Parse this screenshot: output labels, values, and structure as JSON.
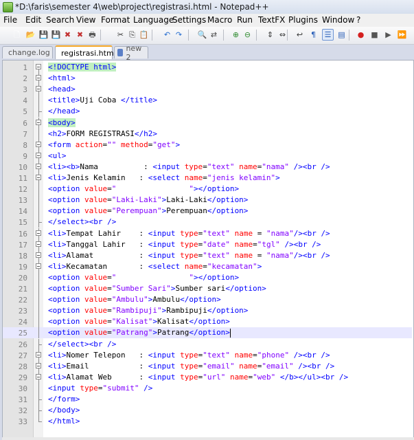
{
  "window": {
    "title": "*D:\\faris\\semester 4\\web\\project\\registrasi.html - Notepad++"
  },
  "menu": [
    "File",
    "Edit",
    "Search",
    "View",
    "Format",
    "Language",
    "Settings",
    "Macro",
    "Run",
    "TextFX",
    "Plugins",
    "Window",
    "?"
  ],
  "toolbar": [
    "new-file-icon",
    "open-file-icon",
    "save-icon",
    "save-all-icon",
    "close-icon",
    "close-all-icon",
    "print-icon",
    "cut-icon",
    "copy-icon",
    "paste-icon",
    "undo-icon",
    "redo-icon",
    "find-icon",
    "replace-icon",
    "zoom-in-icon",
    "zoom-out-icon",
    "sync-vertical-icon",
    "sync-horizontal-icon",
    "word-wrap-icon",
    "show-all-chars-icon",
    "indent-guide-icon",
    "user-lang-icon",
    "record-macro-icon",
    "stop-macro-icon",
    "play-macro-icon",
    "play-multi-icon",
    "save-macro-icon"
  ],
  "tabs": [
    {
      "label": "change.log",
      "active": false,
      "icon_color": "#5b7fc7"
    },
    {
      "label": "registrasi.html",
      "active": true,
      "icon_color": "#e04545"
    },
    {
      "label": "new 2",
      "active": false,
      "icon_color": "#5b7fc7"
    }
  ],
  "colors": {
    "tag": "#0000ff",
    "attribute": "#ff0000",
    "value": "#8000ff",
    "text": "#000000"
  },
  "lines": [
    {
      "n": "1",
      "fold": "open",
      "current": false,
      "tokens": [
        [
          "tag",
          "<!DOCTYPE html>"
        ]
      ],
      "hl": true
    },
    {
      "n": "2",
      "fold": "open",
      "current": false,
      "tokens": [
        [
          "tag",
          "<html>"
        ]
      ]
    },
    {
      "n": "3",
      "fold": "open",
      "current": false,
      "tokens": [
        [
          "tag",
          "<head>"
        ]
      ]
    },
    {
      "n": "4",
      "fold": "mid",
      "current": false,
      "tokens": [
        [
          "tag",
          "<title>"
        ],
        [
          "txt",
          "Uji Coba "
        ],
        [
          "tag",
          "</title>"
        ]
      ]
    },
    {
      "n": "5",
      "fold": "end",
      "current": false,
      "tokens": [
        [
          "tag",
          "</head>"
        ]
      ]
    },
    {
      "n": "6",
      "fold": "open",
      "current": false,
      "tokens": [
        [
          "tag",
          "<body>"
        ]
      ],
      "hl": true
    },
    {
      "n": "7",
      "fold": "mid",
      "current": false,
      "tokens": [
        [
          "tag",
          "<h2>"
        ],
        [
          "txt",
          "FORM REGISTRASI"
        ],
        [
          "tag",
          "</h2>"
        ]
      ]
    },
    {
      "n": "8",
      "fold": "open",
      "current": false,
      "tokens": [
        [
          "tag",
          "<form "
        ],
        [
          "attr",
          "action"
        ],
        [
          "txt",
          "="
        ],
        [
          "val",
          "\"\""
        ],
        [
          "attr",
          " method"
        ],
        [
          "txt",
          "="
        ],
        [
          "val",
          "\"get\""
        ],
        [
          "tag",
          ">"
        ]
      ]
    },
    {
      "n": "9",
      "fold": "open",
      "current": false,
      "tokens": [
        [
          "tag",
          "<ul>"
        ]
      ]
    },
    {
      "n": "10",
      "fold": "open",
      "current": false,
      "tokens": [
        [
          "tag",
          "<li><b>"
        ],
        [
          "txt",
          "Nama          : "
        ],
        [
          "tag",
          "<input "
        ],
        [
          "attr",
          "type"
        ],
        [
          "txt",
          "="
        ],
        [
          "val",
          "\"text\""
        ],
        [
          "attr",
          " name"
        ],
        [
          "txt",
          "="
        ],
        [
          "val",
          "\"nama\""
        ],
        [
          "tag",
          " /><br />"
        ]
      ]
    },
    {
      "n": "11",
      "fold": "open",
      "current": false,
      "tokens": [
        [
          "tag",
          "<li>"
        ],
        [
          "txt",
          "Jenis Kelamin   : "
        ],
        [
          "tag",
          "<select "
        ],
        [
          "attr",
          "name"
        ],
        [
          "txt",
          "="
        ],
        [
          "val",
          "\"jenis kelamin\""
        ],
        [
          "tag",
          ">"
        ]
      ]
    },
    {
      "n": "12",
      "fold": "mid",
      "current": false,
      "tokens": [
        [
          "tag",
          "<option "
        ],
        [
          "attr",
          "value"
        ],
        [
          "txt",
          "="
        ],
        [
          "val",
          "\"                \""
        ],
        [
          "tag",
          "></option>"
        ]
      ]
    },
    {
      "n": "13",
      "fold": "mid",
      "current": false,
      "tokens": [
        [
          "tag",
          "<option "
        ],
        [
          "attr",
          "value"
        ],
        [
          "txt",
          "="
        ],
        [
          "val",
          "\"Laki-Laki\""
        ],
        [
          "tag",
          ">"
        ],
        [
          "txt",
          "Laki-Laki"
        ],
        [
          "tag",
          "</option>"
        ]
      ]
    },
    {
      "n": "14",
      "fold": "mid",
      "current": false,
      "tokens": [
        [
          "tag",
          "<option "
        ],
        [
          "attr",
          "value"
        ],
        [
          "txt",
          "="
        ],
        [
          "val",
          "\"Perempuan\""
        ],
        [
          "tag",
          ">"
        ],
        [
          "txt",
          "Perempuan"
        ],
        [
          "tag",
          "</option>"
        ]
      ]
    },
    {
      "n": "15",
      "fold": "end",
      "current": false,
      "tokens": [
        [
          "tag",
          "</select><br />"
        ]
      ]
    },
    {
      "n": "16",
      "fold": "open",
      "current": false,
      "tokens": [
        [
          "tag",
          "<li>"
        ],
        [
          "txt",
          "Tempat Lahir    : "
        ],
        [
          "tag",
          "<input "
        ],
        [
          "attr",
          "type"
        ],
        [
          "txt",
          "="
        ],
        [
          "val",
          "\"text\""
        ],
        [
          "attr",
          " name "
        ],
        [
          "txt",
          "= "
        ],
        [
          "val",
          "\"nama\""
        ],
        [
          "tag",
          "/><br />"
        ]
      ]
    },
    {
      "n": "17",
      "fold": "open",
      "current": false,
      "tokens": [
        [
          "tag",
          "<li>"
        ],
        [
          "txt",
          "Tanggal Lahir   : "
        ],
        [
          "tag",
          "<input "
        ],
        [
          "attr",
          "type"
        ],
        [
          "txt",
          "="
        ],
        [
          "val",
          "\"date\""
        ],
        [
          "attr",
          " name"
        ],
        [
          "txt",
          "="
        ],
        [
          "val",
          "\"tgl\""
        ],
        [
          "tag",
          " /><br />"
        ]
      ]
    },
    {
      "n": "18",
      "fold": "open",
      "current": false,
      "tokens": [
        [
          "tag",
          "<li>"
        ],
        [
          "txt",
          "Alamat          : "
        ],
        [
          "tag",
          "<input "
        ],
        [
          "attr",
          "type"
        ],
        [
          "txt",
          "="
        ],
        [
          "val",
          "\"text\""
        ],
        [
          "attr",
          " name "
        ],
        [
          "txt",
          "= "
        ],
        [
          "val",
          "\"nama\""
        ],
        [
          "tag",
          "/><br />"
        ]
      ]
    },
    {
      "n": "19",
      "fold": "open",
      "current": false,
      "tokens": [
        [
          "tag",
          "<li>"
        ],
        [
          "txt",
          "Kecamatan       : "
        ],
        [
          "tag",
          "<select "
        ],
        [
          "attr",
          "name"
        ],
        [
          "txt",
          "="
        ],
        [
          "val",
          "\"kecamatan\""
        ],
        [
          "tag",
          ">"
        ]
      ]
    },
    {
      "n": "20",
      "fold": "mid",
      "current": false,
      "tokens": [
        [
          "tag",
          "<option "
        ],
        [
          "attr",
          "value"
        ],
        [
          "txt",
          "="
        ],
        [
          "val",
          "\"                \""
        ],
        [
          "tag",
          "></option>"
        ]
      ]
    },
    {
      "n": "21",
      "fold": "mid",
      "current": false,
      "tokens": [
        [
          "tag",
          "<option "
        ],
        [
          "attr",
          "value"
        ],
        [
          "txt",
          "="
        ],
        [
          "val",
          "\"Sumber Sari\""
        ],
        [
          "tag",
          ">"
        ],
        [
          "txt",
          "Sumber sari"
        ],
        [
          "tag",
          "</option>"
        ]
      ]
    },
    {
      "n": "22",
      "fold": "mid",
      "current": false,
      "tokens": [
        [
          "tag",
          "<option "
        ],
        [
          "attr",
          "value"
        ],
        [
          "txt",
          "="
        ],
        [
          "val",
          "\"Ambulu\""
        ],
        [
          "tag",
          ">"
        ],
        [
          "txt",
          "Ambulu"
        ],
        [
          "tag",
          "</option>"
        ]
      ]
    },
    {
      "n": "23",
      "fold": "mid",
      "current": false,
      "tokens": [
        [
          "tag",
          "<option "
        ],
        [
          "attr",
          "value"
        ],
        [
          "txt",
          "="
        ],
        [
          "val",
          "\"Rambipuji\""
        ],
        [
          "tag",
          ">"
        ],
        [
          "txt",
          "Rambipuji"
        ],
        [
          "tag",
          "</option>"
        ]
      ]
    },
    {
      "n": "24",
      "fold": "mid",
      "current": false,
      "tokens": [
        [
          "tag",
          "<option "
        ],
        [
          "attr",
          "value"
        ],
        [
          "txt",
          "="
        ],
        [
          "val",
          "\"Kalisat\""
        ],
        [
          "tag",
          ">"
        ],
        [
          "txt",
          "Kalisat"
        ],
        [
          "tag",
          "</option>"
        ]
      ]
    },
    {
      "n": "25",
      "fold": "mid",
      "current": true,
      "tokens": [
        [
          "tag",
          "<option "
        ],
        [
          "attr",
          "value"
        ],
        [
          "txt",
          "="
        ],
        [
          "val",
          "\"Patrang\""
        ],
        [
          "tag",
          ">"
        ],
        [
          "txt",
          "Patrang"
        ],
        [
          "tag",
          "</option>"
        ],
        [
          "caret",
          ""
        ]
      ]
    },
    {
      "n": "26",
      "fold": "end",
      "current": false,
      "tokens": [
        [
          "tag",
          "</select><br />"
        ]
      ]
    },
    {
      "n": "27",
      "fold": "open",
      "current": false,
      "tokens": [
        [
          "tag",
          "<li>"
        ],
        [
          "txt",
          "Nomer Telepon   : "
        ],
        [
          "tag",
          "<input "
        ],
        [
          "attr",
          "type"
        ],
        [
          "txt",
          "="
        ],
        [
          "val",
          "\"text\""
        ],
        [
          "attr",
          " name"
        ],
        [
          "txt",
          "="
        ],
        [
          "val",
          "\"phone\""
        ],
        [
          "tag",
          " /><br />"
        ]
      ]
    },
    {
      "n": "28",
      "fold": "open",
      "current": false,
      "tokens": [
        [
          "tag",
          "<li>"
        ],
        [
          "txt",
          "Email           : "
        ],
        [
          "tag",
          "<input "
        ],
        [
          "attr",
          "type"
        ],
        [
          "txt",
          "="
        ],
        [
          "val",
          "\"email\""
        ],
        [
          "attr",
          " name"
        ],
        [
          "txt",
          "="
        ],
        [
          "val",
          "\"email\""
        ],
        [
          "tag",
          " /><br />"
        ]
      ]
    },
    {
      "n": "29",
      "fold": "open",
      "current": false,
      "tokens": [
        [
          "tag",
          "<li>"
        ],
        [
          "txt",
          "Alamat Web      : "
        ],
        [
          "tag",
          "<input "
        ],
        [
          "attr",
          "type"
        ],
        [
          "txt",
          "="
        ],
        [
          "val",
          "\"url\""
        ],
        [
          "attr",
          " name"
        ],
        [
          "txt",
          "="
        ],
        [
          "val",
          "\"web\""
        ],
        [
          "tag",
          " </b></ul><br />"
        ]
      ]
    },
    {
      "n": "30",
      "fold": "mid",
      "current": false,
      "tokens": [
        [
          "tag",
          "<input "
        ],
        [
          "attr",
          "type"
        ],
        [
          "txt",
          "="
        ],
        [
          "val",
          "\"submit\""
        ],
        [
          "tag",
          " />"
        ]
      ]
    },
    {
      "n": "31",
      "fold": "end",
      "current": false,
      "tokens": [
        [
          "tag",
          "</form>"
        ]
      ]
    },
    {
      "n": "32",
      "fold": "end",
      "current": false,
      "tokens": [
        [
          "tag",
          "</body>"
        ]
      ]
    },
    {
      "n": "33",
      "fold": "end",
      "current": false,
      "tokens": [
        [
          "tag",
          "</html>"
        ]
      ]
    }
  ]
}
